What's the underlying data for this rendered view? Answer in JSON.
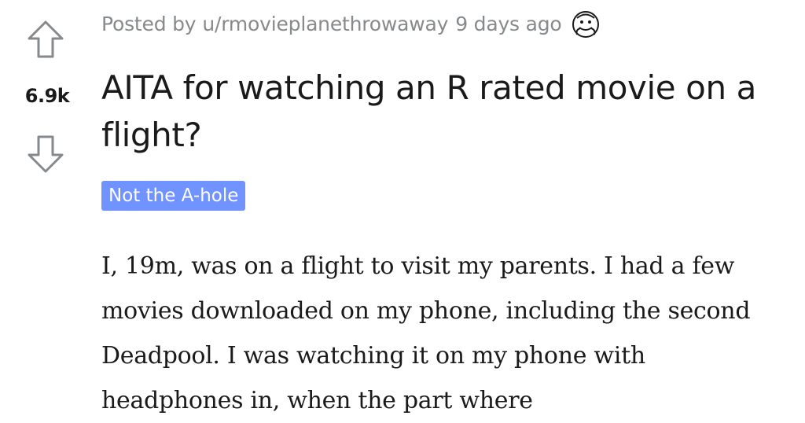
{
  "vote": {
    "score": "6.9k"
  },
  "post": {
    "meta": {
      "posted_by_label": "Posted by",
      "author": "u/rmovieplanethrowaway",
      "age": "9 days ago",
      "award_icon": "hugz-award-icon"
    },
    "title": "AITA for watching an R rated movie on a flight?",
    "flair": {
      "label": "Not the A-hole",
      "color": "#7193ff"
    },
    "body": "I, 19m, was on a flight to visit my parents. I had a few movies downloaded on my phone, including the second Deadpool. I was watching it on my phone with headphones in, when the part where"
  },
  "colors": {
    "meta_text": "#878a8c",
    "text": "#1a1a1b",
    "arrow": "#878a8c"
  }
}
